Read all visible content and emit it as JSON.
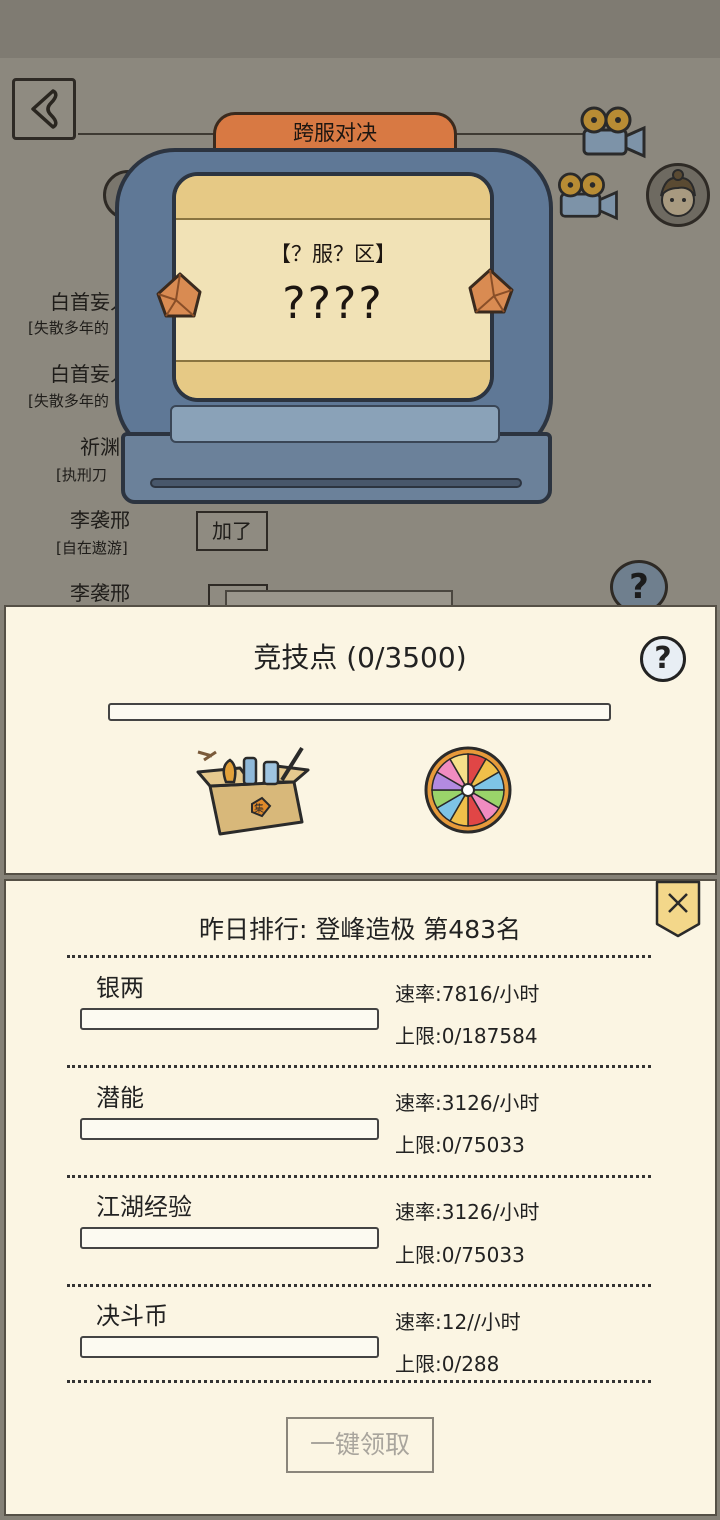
{
  "background": {
    "players": [
      {
        "name": "白首妄人",
        "tag": "[失散多年的"
      },
      {
        "name": "白首妄人",
        "tag": "[失散多年的"
      },
      {
        "name": "祈渊",
        "tag": "[执刑刀"
      },
      {
        "name": "李袭邢",
        "tag": "[自在遨游]"
      },
      {
        "name": "李袭邢",
        "tag": ""
      }
    ],
    "chat_bubble": "加了"
  },
  "machine": {
    "sign": "跨服对决",
    "server": "【？服？区】",
    "opponent": "????"
  },
  "arena": {
    "title": "竞技点 (0/3500)",
    "progress": 0,
    "help": "?"
  },
  "ranking": {
    "title": "昨日排行:  登峰造极 第483名",
    "close": "×",
    "resources": [
      {
        "name": "银两",
        "rate": "速率:7816/小时",
        "cap": "上限:0/187584",
        "progress": 0
      },
      {
        "name": "潜能",
        "rate": "速率:3126/小时",
        "cap": "上限:0/75033",
        "progress": 0
      },
      {
        "name": "江湖经验",
        "rate": "速率:3126/小时",
        "cap": "上限:0/75033",
        "progress": 0
      },
      {
        "name": "决斗币",
        "rate": "速率:12//小时",
        "cap": "上限:0/288",
        "progress": 0
      }
    ],
    "claim_button": "一键领取"
  },
  "colors": {
    "panel_bg": "#fbf5e3",
    "machine_blue": "#5f7896",
    "sign_orange": "#d87943",
    "screen_cream": "#f1e2b6"
  }
}
